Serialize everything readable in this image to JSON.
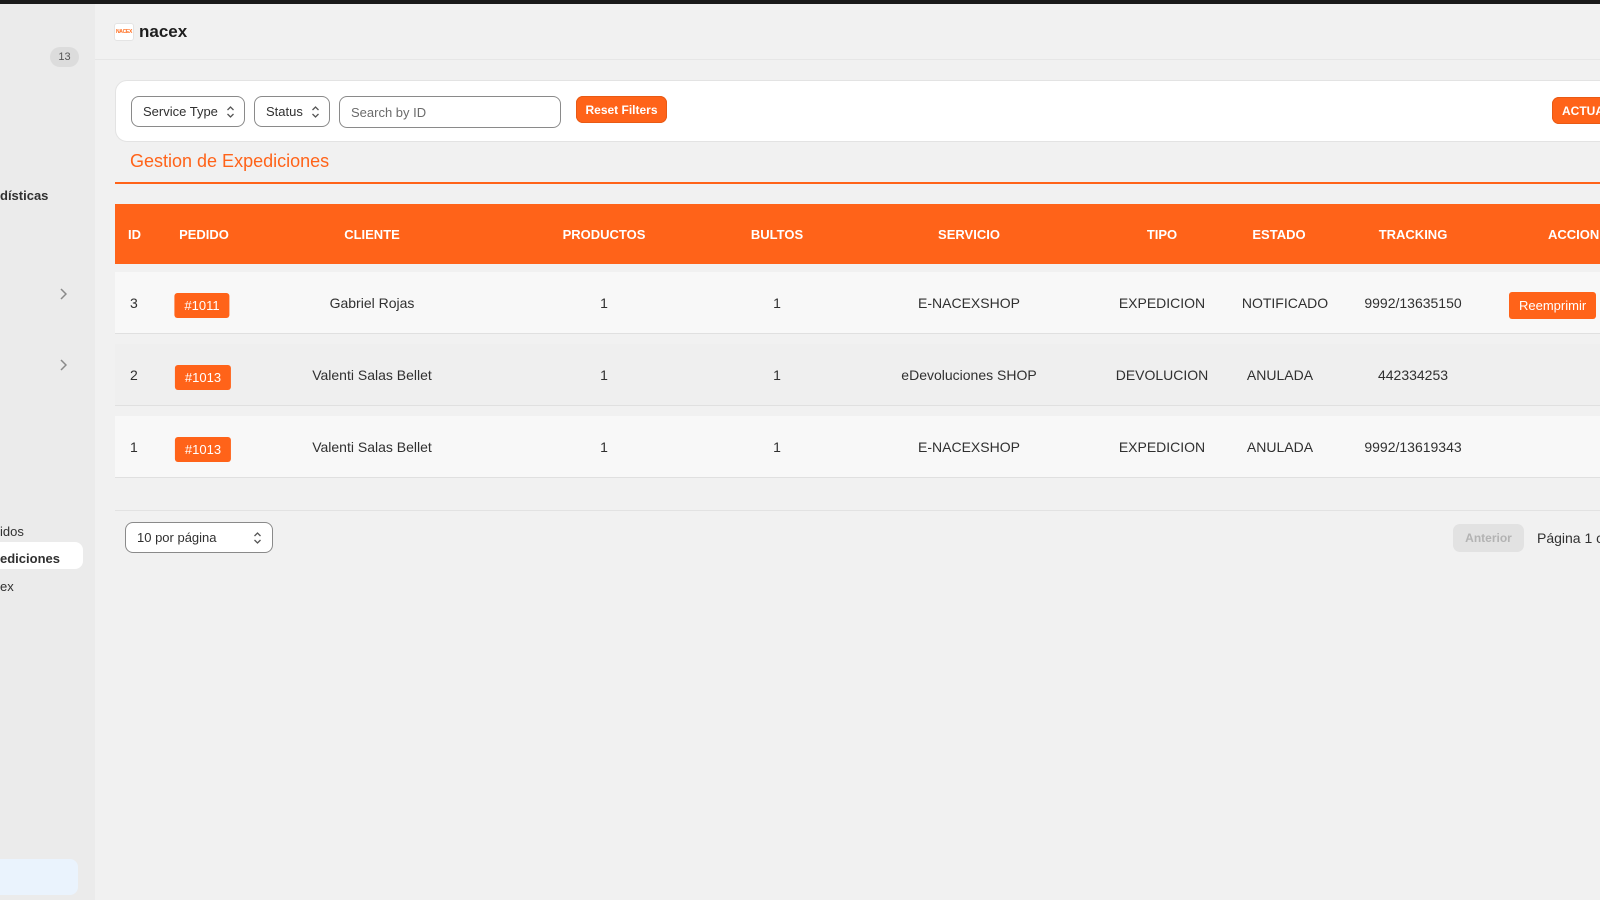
{
  "sidebar": {
    "badge": "13",
    "items": [
      {
        "label": "dísticas"
      },
      {
        "label": "idos"
      },
      {
        "label": "ediciones"
      },
      {
        "label": "ex"
      }
    ]
  },
  "header": {
    "logo_text": "NACEX",
    "title": "nacex"
  },
  "filters": {
    "service_type": "Service Type",
    "status": "Status",
    "search_placeholder": "Search by ID",
    "reset_label": "Reset Filters",
    "refresh_label": "ACTUA"
  },
  "section_title": "Gestion de Expediciones",
  "table": {
    "columns": [
      "ID",
      "PEDIDO",
      "CLIENTE",
      "PRODUCTOS",
      "BULTOS",
      "SERVICIO",
      "TIPO",
      "ESTADO",
      "TRACKING",
      "ACCIONI"
    ],
    "rows": [
      {
        "id": "3",
        "pedido": "#1011",
        "cliente": "Gabriel Rojas",
        "productos": "1",
        "bultos": "1",
        "servicio": "E-NACEXSHOP",
        "tipo": "EXPEDICION",
        "estado": "NOTIFICADO",
        "tracking": "9992/13635150",
        "accion": "Reemprimir"
      },
      {
        "id": "2",
        "pedido": "#1013",
        "cliente": "Valenti Salas Bellet",
        "productos": "1",
        "bultos": "1",
        "servicio": "eDevoluciones SHOP",
        "tipo": "DEVOLUCION",
        "estado": "ANULADA",
        "tracking": "442334253",
        "accion": ""
      },
      {
        "id": "1",
        "pedido": "#1013",
        "cliente": "Valenti Salas Bellet",
        "productos": "1",
        "bultos": "1",
        "servicio": "E-NACEXSHOP",
        "tipo": "EXPEDICION",
        "estado": "ANULADA",
        "tracking": "9992/13619343",
        "accion": ""
      }
    ]
  },
  "pagination": {
    "per_page": "10 por página",
    "prev_label": "Anterior",
    "page_info": "Página 1 c"
  },
  "colors": {
    "accent": "#ff6319",
    "background": "#f1f1f1"
  }
}
